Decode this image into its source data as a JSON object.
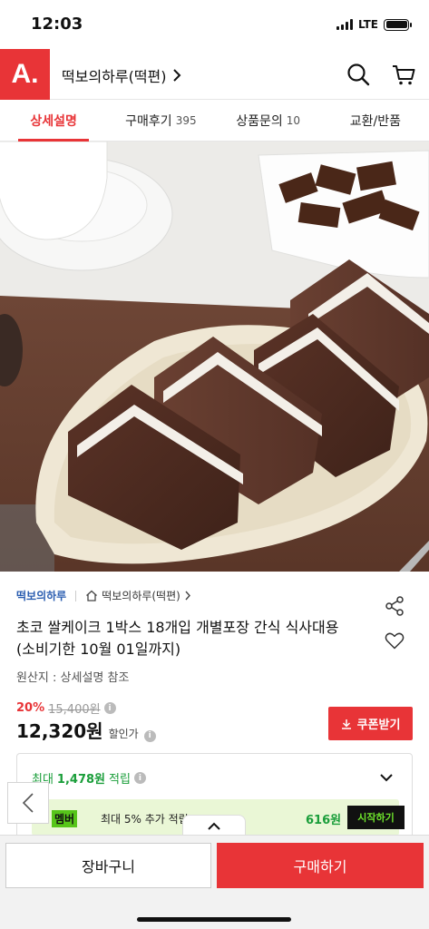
{
  "status_bar": {
    "time": "12:03",
    "network": "LTE"
  },
  "header": {
    "logo": "A.",
    "store_name": "떡보의하루(떡편)"
  },
  "tabs": [
    {
      "label": "상세설명",
      "count": ""
    },
    {
      "label": "구매후기",
      "count": "395"
    },
    {
      "label": "상품문의",
      "count": "10"
    },
    {
      "label": "교환/반품",
      "count": ""
    }
  ],
  "product": {
    "brand": "떡보의하루",
    "shop": "떡보의하루(떡편)",
    "title": "초코 쌀케이크 1박스 18개입 개별포장 간식 식사대용 (소비기한 10월 01일까지)",
    "origin": "원산지 : 상세설명 참조"
  },
  "price": {
    "discount_rate": "20%",
    "original_price": "15,400원",
    "sale_price": "12,320원",
    "sale_label": "할인가",
    "coupon_label": "쿠폰받기"
  },
  "points": {
    "prefix": "최대",
    "amount": "1,478원",
    "suffix": "적립",
    "member_badge": "멤버",
    "member_desc": "최대 5% 추가 적립",
    "member_amount": "616원",
    "member_start": "시작하기"
  },
  "bottom_bar": {
    "cart_label": "장바구니",
    "buy_label": "구매하기"
  },
  "colors": {
    "accent": "#e83437",
    "brand_link": "#2a5db0",
    "points_green": "#1a9e3a",
    "member_bg": "#eaf7d6"
  }
}
